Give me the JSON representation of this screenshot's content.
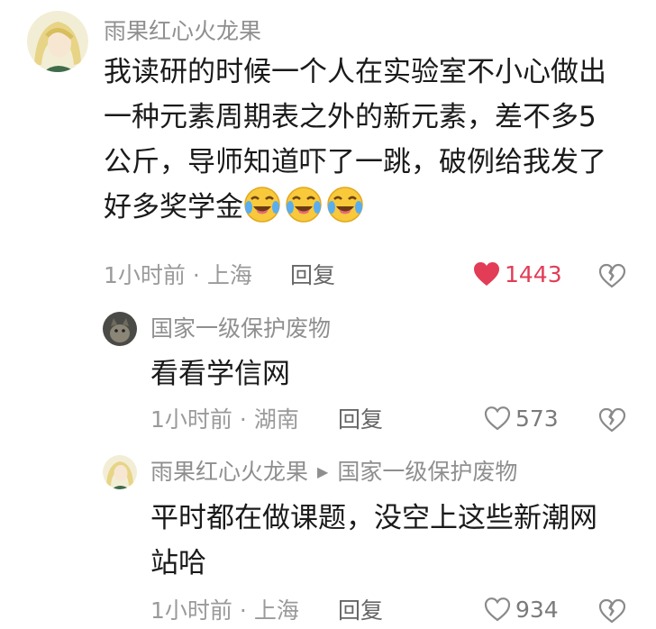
{
  "comments": [
    {
      "username": "雨果红心火龙果",
      "lines": [
        "我读研的时候一个人在实验室不小心做出",
        "一种元素周期表之外的新元素，差不多5",
        "公斤，导师知道吓了一跳，破例给我发了",
        "好多奖学金"
      ],
      "emoji_count": 3,
      "time": "1小时前",
      "location": "上海",
      "reply_label": "回复",
      "likes": "1443",
      "liked": true
    },
    {
      "username": "国家一级保护废物",
      "lines": [
        "看看学信网"
      ],
      "time": "1小时前",
      "location": "湖南",
      "reply_label": "回复",
      "likes": "573",
      "liked": false
    },
    {
      "username": "雨果红心火龙果",
      "reply_to": "国家一级保护废物",
      "lines": [
        "平时都在做课题，没空上这些新潮网",
        "站哈"
      ],
      "time": "1小时前",
      "location": "上海",
      "reply_label": "回复",
      "likes": "934",
      "liked": false
    }
  ],
  "colors": {
    "like_active": "#e23c56",
    "meta_gray": "#9a9a9a",
    "name_gray": "#8f8f8f"
  },
  "icons": {
    "like": "heart-icon",
    "dislike": "broken-heart-icon",
    "emoji": "crying-laughing-emoji",
    "reply_arrow": "caret-right-icon"
  }
}
